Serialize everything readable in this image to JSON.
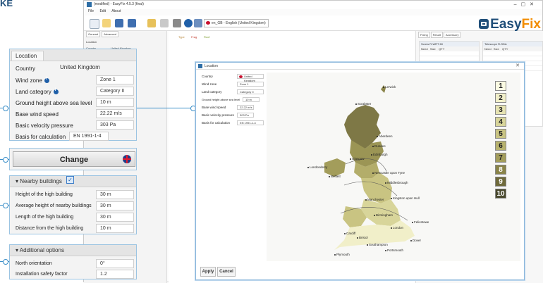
{
  "brand_fragment": "KE",
  "app": {
    "title": "(modified) - EasyFix 4.5.3 (final)",
    "menu": [
      "File",
      "Edit",
      "About"
    ],
    "language_select": "en_GB - English (United Kingdom)",
    "logo_easy": "Easy",
    "logo_fix": "Fix",
    "bg_tabs": [
      "General",
      "Advanced"
    ],
    "bg_fields": [
      "Location",
      "Country",
      "Wind zone",
      "Land category",
      "Ground height",
      "Base wind speed",
      "Basic velocity pressure",
      "Basis for calculation"
    ],
    "bg_values": [
      "United Kingdom",
      "Zone 1",
      "Category II",
      "10 m",
      "22.22 m/s",
      "303 Pa"
    ],
    "bg_legend": [
      "Type",
      "Frag",
      "Roof"
    ],
    "right_tabs": [
      "Fixing",
      "Result",
      "Accessory"
    ],
    "grid_left_title": "Screw R-WRT 60",
    "grid_right_title": "Telescope R-SDA",
    "grid_cols": [
      "Need",
      "Size",
      "QTY"
    ]
  },
  "location_panel": {
    "tab_label": "Location",
    "rows": [
      {
        "label": "Country",
        "value": "United Kingdom"
      },
      {
        "label": "Wind zone",
        "value": "Zone 1"
      },
      {
        "label": "Land category",
        "value": "Category II"
      },
      {
        "label": "Ground height above sea level",
        "value": "10 m"
      },
      {
        "label": "Base wind speed",
        "value": "22.22 m/s"
      },
      {
        "label": "Basic velocity pressure",
        "value": "303 Pa"
      },
      {
        "label": "Basis for calculation",
        "value": "EN 1991-1-4"
      }
    ]
  },
  "change_button": {
    "label": "Change"
  },
  "nearby_buildings": {
    "header": "Nearby buildings",
    "checked": true,
    "rows": [
      {
        "label": "Height of the high building",
        "value": "30 m"
      },
      {
        "label": "Average height of nearby buildings",
        "value": "30 m"
      },
      {
        "label": "Length of the high building",
        "value": "30 m"
      },
      {
        "label": "Distance from the high building",
        "value": "10 m"
      }
    ]
  },
  "additional_options": {
    "header": "Additional options",
    "rows": [
      {
        "label": "North orientation",
        "value": "0°"
      },
      {
        "label": "Installation safety factor",
        "value": "1.2"
      }
    ]
  },
  "dialog": {
    "title": "Location",
    "fields": [
      {
        "label": "Country",
        "value": "United Kingdom"
      },
      {
        "label": "Wind zone",
        "value": "Zone 1"
      },
      {
        "label": "Land category",
        "value": "Category II"
      },
      {
        "label": "Ground height above sea level",
        "value": "10 m"
      },
      {
        "label": "Base wind speed",
        "value": "22.22 m/s"
      },
      {
        "label": "Basic velocity pressure",
        "value": "303 Pa"
      },
      {
        "label": "Basis for calculation",
        "value": "EN 1991-1-4"
      }
    ],
    "zones": [
      "1",
      "2",
      "3",
      "4",
      "5",
      "6",
      "7",
      "8",
      "9",
      "10"
    ],
    "zone_colors": [
      "#fbfbe3",
      "#f1efc9",
      "#e6e3b2",
      "#d8d59a",
      "#c9c482",
      "#b7b26d",
      "#a39d5b",
      "#8a8449",
      "#6f6a3b",
      "#4a4a2e"
    ],
    "cities": [
      "Lerwick",
      "Scrabster",
      "Aberdeen",
      "Dundee",
      "Edinburgh",
      "Glasgow",
      "Londonderry",
      "Belfast",
      "Newcastle upon Tyne",
      "Middlesbrough",
      "Manchester",
      "Kingston upon Hull",
      "Birmingham",
      "Cardiff",
      "Bristol",
      "London",
      "Felixstowe",
      "Southampton",
      "Dover",
      "Plymouth",
      "Portsmouth"
    ],
    "apply_label": "Apply",
    "cancel_label": "Cancel"
  }
}
